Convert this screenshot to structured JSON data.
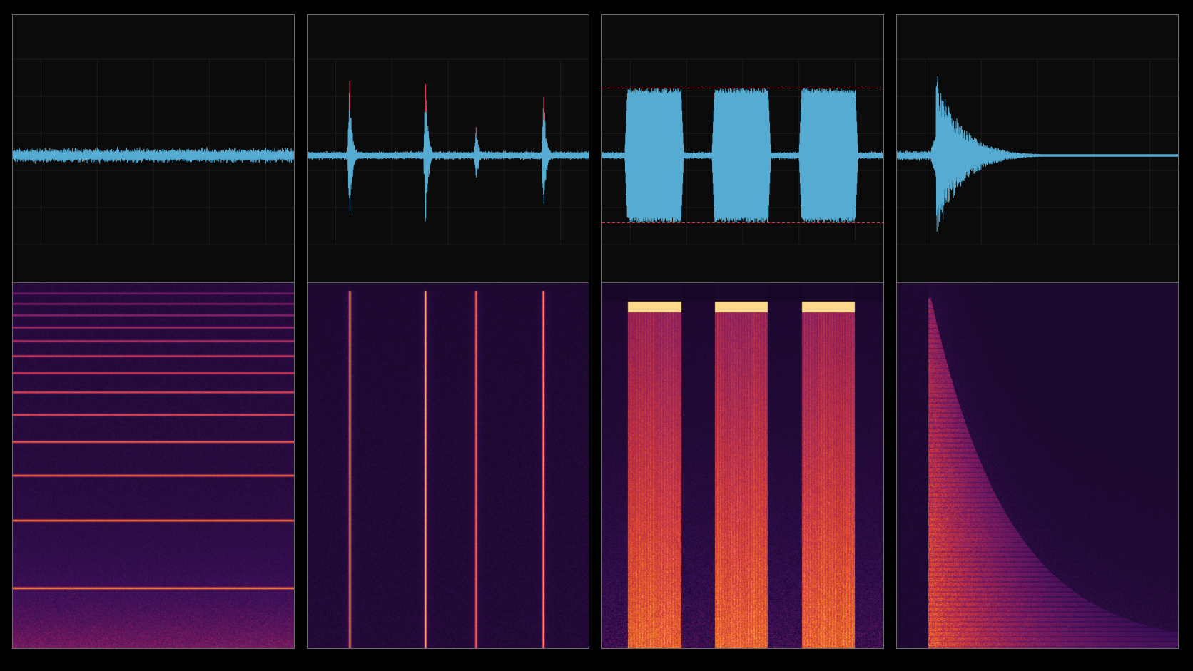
{
  "colors": {
    "background": "#000000",
    "panel_border": "#6b6b6b",
    "waveform": "#5ab4dc",
    "peak_marker": "#e2304e",
    "spectrogram_low": "#120622",
    "spectrogram_mid": "#7a1b5c",
    "spectrogram_high": "#f07a2a",
    "spectrogram_peak": "#fde7a0"
  },
  "chart_data": [
    {
      "type": "line",
      "kind": "waveform-and-spectrogram",
      "waveform": {
        "pattern": "steady-noise",
        "amplitude": 0.1
      },
      "spectrogram": {
        "pattern": "horizontal-harmonics",
        "harmonic_lines": 13
      }
    },
    {
      "type": "line",
      "kind": "waveform-and-spectrogram",
      "waveform": {
        "pattern": "impulses",
        "impulse_count": 4,
        "impulse_times": [
          0.15,
          0.42,
          0.6,
          0.84
        ],
        "impulse_peaks": [
          1.0,
          0.95,
          0.38,
          0.78
        ]
      },
      "spectrogram": {
        "pattern": "vertical-lines",
        "line_count": 4
      }
    },
    {
      "type": "line",
      "kind": "waveform-and-spectrogram",
      "waveform": {
        "pattern": "tone-bursts",
        "burst_count": 3,
        "burst_amplitude": 0.9,
        "clip_lines": true
      },
      "spectrogram": {
        "pattern": "broadband-bursts",
        "burst_count": 3
      }
    },
    {
      "type": "line",
      "kind": "waveform-and-spectrogram",
      "waveform": {
        "pattern": "decaying-transient",
        "onset": 0.14,
        "peak": 1.0
      },
      "spectrogram": {
        "pattern": "decaying-broadband"
      }
    }
  ]
}
